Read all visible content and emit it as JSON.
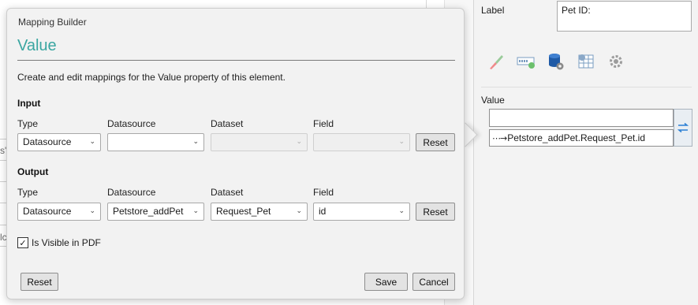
{
  "dialog": {
    "caption": "Mapping Builder",
    "title": "Value",
    "description": "Create and edit mappings for the Value property of this element.",
    "input": {
      "heading": "Input",
      "labels": {
        "type": "Type",
        "datasource": "Datasource",
        "dataset": "Dataset",
        "field": "Field"
      },
      "type_value": "Datasource",
      "datasource_value": "",
      "dataset_value": "",
      "field_value": "",
      "reset_label": "Reset"
    },
    "output": {
      "heading": "Output",
      "labels": {
        "type": "Type",
        "datasource": "Datasource",
        "dataset": "Dataset",
        "field": "Field"
      },
      "type_value": "Datasource",
      "datasource_value": "Petstore_addPet",
      "dataset_value": "Request_Pet",
      "field_value": "id",
      "reset_label": "Reset"
    },
    "visible_in_pdf": {
      "label": "Is Visible in PDF",
      "checked": true
    },
    "footer": {
      "reset_label": "Reset",
      "save_label": "Save",
      "cancel_label": "Cancel"
    }
  },
  "background": {
    "fragments": [
      "s'",
      "lc"
    ]
  },
  "properties_panel": {
    "label_caption": "Label",
    "label_value": "Pet ID:",
    "tabs": [
      "paint-brush-icon",
      "input-field-icon",
      "database-settings-icon",
      "table-calculation-icon",
      "gear-icon"
    ],
    "value_caption": "Value",
    "value_input": "",
    "mapping_text": "Petstore_addPet.Request_Pet.id"
  },
  "colors": {
    "accent": "#3aa6a1",
    "dialog_bg": "#f2f2f2",
    "panel_bg": "#f3f3f3"
  }
}
